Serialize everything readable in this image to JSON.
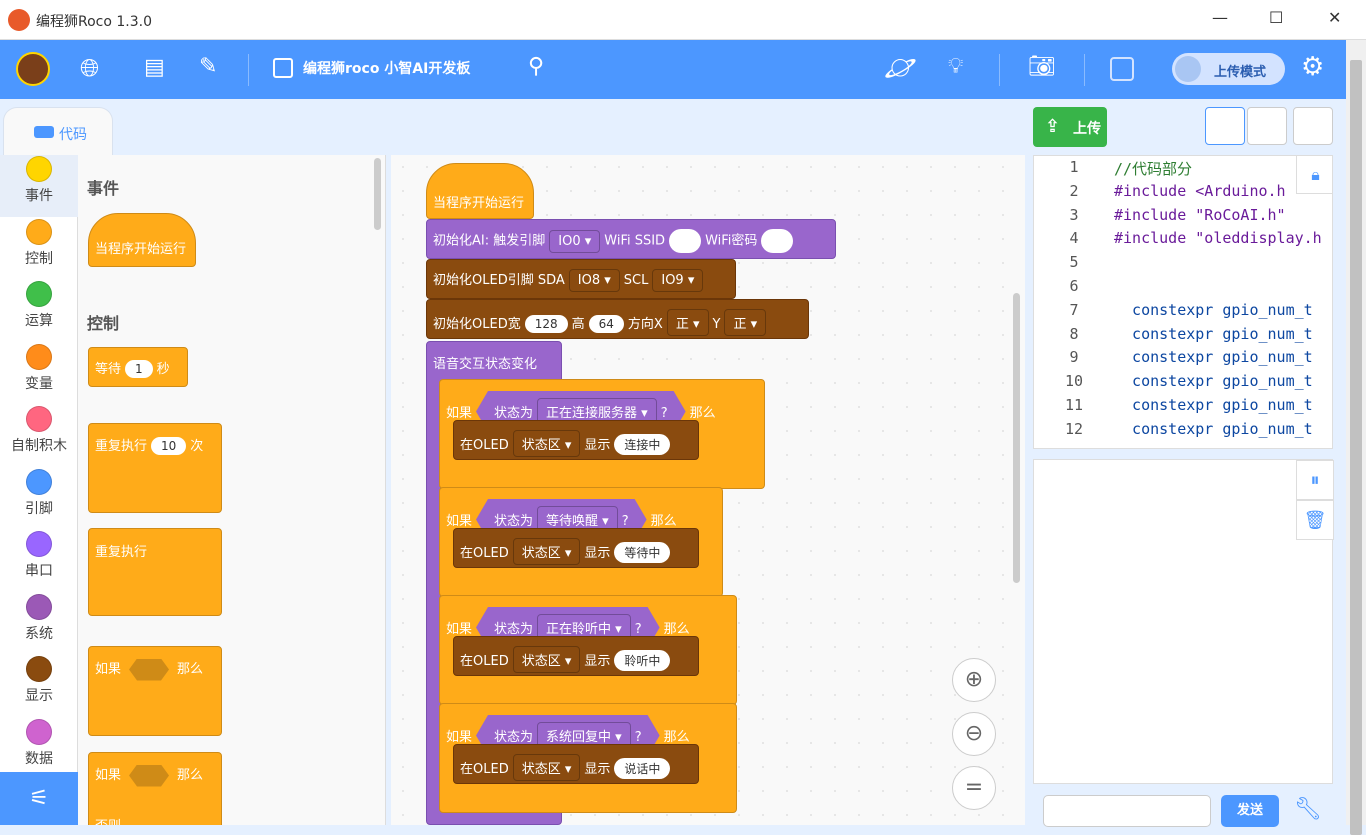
{
  "window": {
    "title": "编程狮Roco 1.3.0",
    "min": "—",
    "max": "☐",
    "close": "✕"
  },
  "toolbar": {
    "board": "编程狮roco 小智AI开发板",
    "mode_label": "上传模式"
  },
  "tabs": {
    "code": "代码"
  },
  "categories": [
    {
      "label": "事件",
      "color": "#ffd500"
    },
    {
      "label": "控制",
      "color": "#ffab19"
    },
    {
      "label": "运算",
      "color": "#40bf4a"
    },
    {
      "label": "变量",
      "color": "#ff8c1a"
    },
    {
      "label": "自制积木",
      "color": "#ff6680"
    },
    {
      "label": "引脚",
      "color": "#4c97ff"
    },
    {
      "label": "串口",
      "color": "#9966ff"
    },
    {
      "label": "系统",
      "color": "#9b59b6"
    },
    {
      "label": "显示",
      "color": "#8a4b0f"
    },
    {
      "label": "数据",
      "color": "#cf63cf"
    }
  ],
  "palette": {
    "events_title": "事件",
    "on_start": "当程序开始运行",
    "control_title": "控制",
    "wait": {
      "label": "等待",
      "value": "1",
      "unit": "秒"
    },
    "repeat_n": {
      "label": "重复执行",
      "value": "10",
      "unit": "次"
    },
    "forever": "重复执行",
    "if1": {
      "if": "如果",
      "then": "那么"
    },
    "if2": {
      "if": "如果",
      "then": "那么"
    },
    "else": "否则"
  },
  "script": {
    "hat": "当程序开始运行",
    "init_ai": {
      "label": "初始化AI: 触发引脚",
      "pin": "IO0",
      "ssid_label": "WiFi SSID",
      "ssid": "",
      "pwd_label": "WiFi密码",
      "pwd": ""
    },
    "init_oled_pins": {
      "label": "初始化OLED引脚 SDA",
      "sda": "IO8",
      "scl_label": "SCL",
      "scl": "IO9"
    },
    "init_oled_size": {
      "label": "初始化OLED宽",
      "w": "128",
      "h_label": "高",
      "h": "64",
      "dx_label": "方向X",
      "dx": "正",
      "dy_label": "Y",
      "dy": "正"
    },
    "voice_event": "语音交互状态变化",
    "ifs": [
      {
        "if": "如果",
        "cond": "状态为",
        "state": "正在连接服务器",
        "q": "?",
        "then": "那么",
        "show": "在OLED",
        "area": "状态区",
        "disp": "显示",
        "text": "连接中"
      },
      {
        "if": "如果",
        "cond": "状态为",
        "state": "等待唤醒",
        "q": "?",
        "then": "那么",
        "show": "在OLED",
        "area": "状态区",
        "disp": "显示",
        "text": "等待中"
      },
      {
        "if": "如果",
        "cond": "状态为",
        "state": "正在聆听中",
        "q": "?",
        "then": "那么",
        "show": "在OLED",
        "area": "状态区",
        "disp": "显示",
        "text": "聆听中"
      },
      {
        "if": "如果",
        "cond": "状态为",
        "state": "系统回复中",
        "q": "?",
        "then": "那么",
        "show": "在OLED",
        "area": "状态区",
        "disp": "显示",
        "text": "说话中"
      }
    ]
  },
  "right": {
    "upload": "上传",
    "send": "发送"
  },
  "code": {
    "line_numbers": [
      "1",
      "2",
      "3",
      "4",
      "5",
      "6",
      "7",
      "8",
      "9",
      "10",
      "11",
      "12"
    ],
    "lines": [
      "//代码部分",
      "#include <Arduino.h",
      "#include \"RoCoAI.h\"",
      "#include \"oleddisplay.h",
      "",
      "",
      "  constexpr gpio_num_t",
      "  constexpr gpio_num_t",
      "  constexpr gpio_num_t",
      "  constexpr gpio_num_t",
      "  constexpr gpio_num_t",
      "  constexpr gpio_num_t"
    ]
  }
}
